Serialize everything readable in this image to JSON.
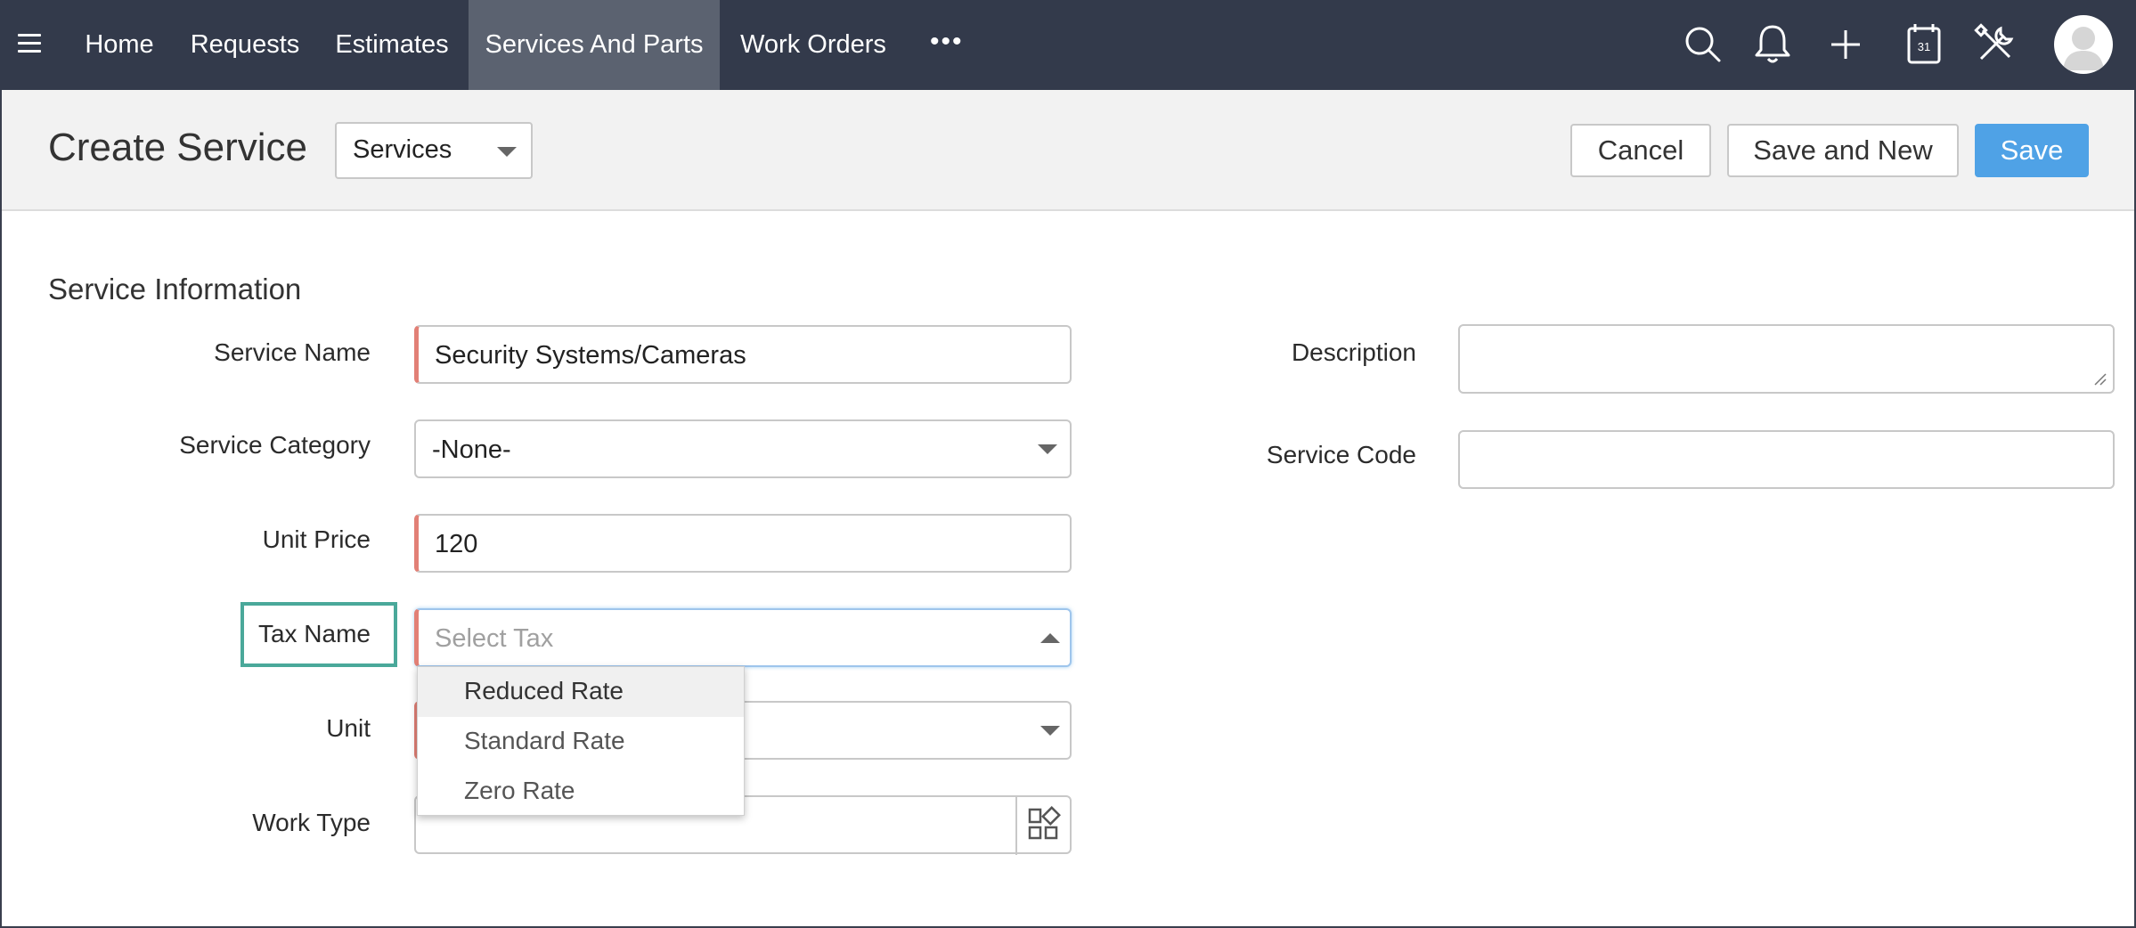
{
  "nav": {
    "tabs": [
      {
        "label": "Home"
      },
      {
        "label": "Requests"
      },
      {
        "label": "Estimates"
      },
      {
        "label": "Services And Parts",
        "active": true
      },
      {
        "label": "Work Orders"
      }
    ],
    "more": "•••",
    "icons": [
      "search-icon",
      "bell-icon",
      "plus-icon",
      "calendar-icon",
      "tools-icon",
      "avatar"
    ],
    "calendar_day": "31"
  },
  "header": {
    "title": "Create Service",
    "module_select": "Services",
    "cancel_label": "Cancel",
    "save_new_label": "Save and New",
    "save_label": "Save"
  },
  "form": {
    "section_title": "Service Information",
    "service_name": {
      "label": "Service Name",
      "value": "Security Systems/Cameras"
    },
    "service_category": {
      "label": "Service Category",
      "value": "-None-"
    },
    "unit_price": {
      "label": "Unit Price",
      "value": "120"
    },
    "tax_name": {
      "label": "Tax Name",
      "placeholder": "Select Tax",
      "options": [
        "Reduced Rate",
        "Standard Rate",
        "Zero Rate"
      ]
    },
    "unit": {
      "label": "Unit",
      "value": ""
    },
    "work_type": {
      "label": "Work Type",
      "value": ""
    },
    "description": {
      "label": "Description",
      "value": ""
    },
    "service_code": {
      "label": "Service Code",
      "value": ""
    }
  },
  "colors": {
    "nav_bg": "#333a4b",
    "nav_active": "#5b6270",
    "primary": "#4fa2e6",
    "required_marker": "#e28076",
    "highlight": "#4aa89a"
  }
}
